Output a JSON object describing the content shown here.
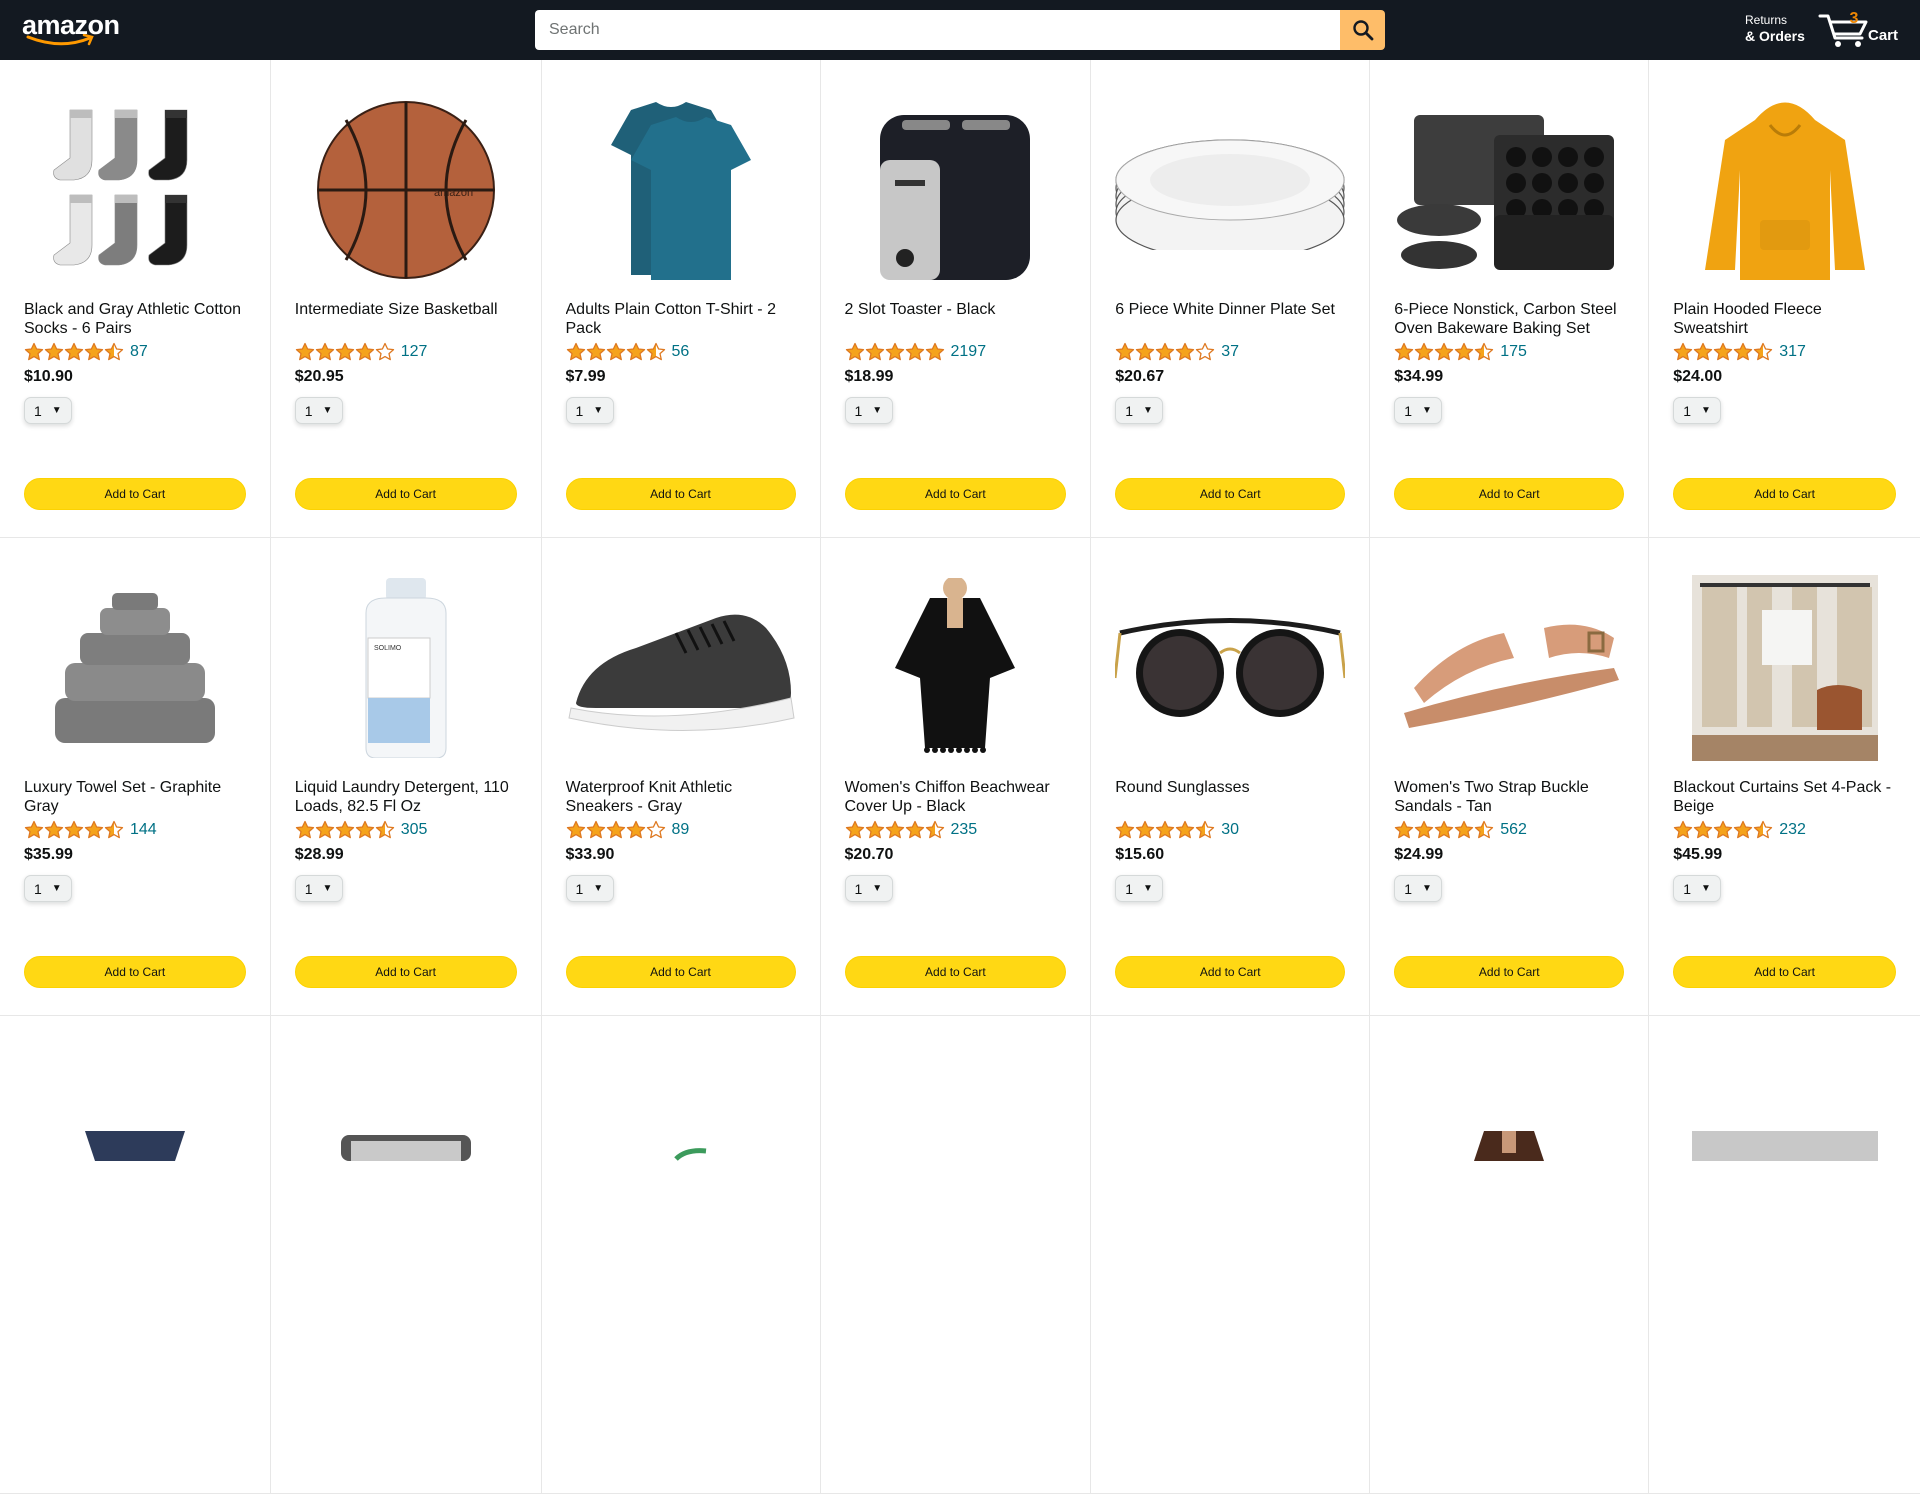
{
  "header": {
    "logo_text": "amazon",
    "search_placeholder": "Search",
    "returns_small": "Returns",
    "returns_big": "& Orders",
    "cart_count": "3",
    "cart_label": "Cart"
  },
  "colors": {
    "header_bg": "#131921",
    "search_button": "#febd69",
    "cart_count": "#f08804",
    "star": "#f5a31b",
    "link": "#007185",
    "add_button": "#ffd814"
  },
  "products": [
    {
      "name": "Black and Gray Athletic Cotton Socks - 6 Pairs",
      "rating": 4.5,
      "count": "87",
      "price": "$10.90",
      "qty": "1",
      "button": "Add to Cart",
      "image": "socks"
    },
    {
      "name": "Intermediate Size Basketball",
      "rating": 4.0,
      "count": "127",
      "price": "$20.95",
      "qty": "1",
      "button": "Add to Cart",
      "image": "basketball"
    },
    {
      "name": "Adults Plain Cotton T-Shirt - 2 Pack",
      "rating": 4.5,
      "count": "56",
      "price": "$7.99",
      "qty": "1",
      "button": "Add to Cart",
      "image": "tshirt"
    },
    {
      "name": "2 Slot Toaster - Black",
      "rating": 5.0,
      "count": "2197",
      "price": "$18.99",
      "qty": "1",
      "button": "Add to Cart",
      "image": "toaster"
    },
    {
      "name": "6 Piece White Dinner Plate Set",
      "rating": 4.0,
      "count": "37",
      "price": "$20.67",
      "qty": "1",
      "button": "Add to Cart",
      "image": "plates"
    },
    {
      "name": "6-Piece Nonstick, Carbon Steel Oven Bakeware Baking Set",
      "rating": 4.5,
      "count": "175",
      "price": "$34.99",
      "qty": "1",
      "button": "Add to Cart",
      "image": "bakeware"
    },
    {
      "name": "Plain Hooded Fleece Sweatshirt",
      "rating": 4.5,
      "count": "317",
      "price": "$24.00",
      "qty": "1",
      "button": "Add to Cart",
      "image": "hoodie"
    },
    {
      "name": "Luxury Towel Set - Graphite Gray",
      "rating": 4.5,
      "count": "144",
      "price": "$35.99",
      "qty": "1",
      "button": "Add to Cart",
      "image": "towels"
    },
    {
      "name": "Liquid Laundry Detergent, 110 Loads, 82.5 Fl Oz",
      "rating": 4.5,
      "count": "305",
      "price": "$28.99",
      "qty": "1",
      "button": "Add to Cart",
      "image": "detergent"
    },
    {
      "name": "Waterproof Knit Athletic Sneakers - Gray",
      "rating": 4.0,
      "count": "89",
      "price": "$33.90",
      "qty": "1",
      "button": "Add to Cart",
      "image": "sneaker"
    },
    {
      "name": "Women's Chiffon Beachwear Cover Up - Black",
      "rating": 4.5,
      "count": "235",
      "price": "$20.70",
      "qty": "1",
      "button": "Add to Cart",
      "image": "coverup"
    },
    {
      "name": "Round Sunglasses",
      "rating": 4.5,
      "count": "30",
      "price": "$15.60",
      "qty": "1",
      "button": "Add to Cart",
      "image": "sunglasses"
    },
    {
      "name": "Women's Two Strap Buckle Sandals - Tan",
      "rating": 4.5,
      "count": "562",
      "price": "$24.99",
      "qty": "1",
      "button": "Add to Cart",
      "image": "sandals"
    },
    {
      "name": "Blackout Curtains Set 4-Pack - Beige",
      "rating": 4.5,
      "count": "232",
      "price": "$45.99",
      "qty": "1",
      "button": "Add to Cart",
      "image": "curtains"
    },
    {
      "name": "",
      "rating": 0,
      "count": "",
      "price": "",
      "qty": "",
      "button": "",
      "image": "jeans"
    },
    {
      "name": "",
      "rating": 0,
      "count": "",
      "price": "",
      "qty": "",
      "button": "",
      "image": "kettle"
    },
    {
      "name": "",
      "rating": 0,
      "count": "",
      "price": "",
      "qty": "",
      "button": "",
      "image": "green"
    },
    {
      "name": "",
      "rating": 0,
      "count": "",
      "price": "",
      "qty": "",
      "button": "",
      "image": "blank"
    },
    {
      "name": "",
      "rating": 0,
      "count": "",
      "price": "",
      "qty": "",
      "button": "",
      "image": "blank"
    },
    {
      "name": "",
      "rating": 0,
      "count": "",
      "price": "",
      "qty": "",
      "button": "",
      "image": "woman"
    },
    {
      "name": "",
      "rating": 0,
      "count": "",
      "price": "",
      "qty": "",
      "button": "",
      "image": "gray"
    }
  ]
}
